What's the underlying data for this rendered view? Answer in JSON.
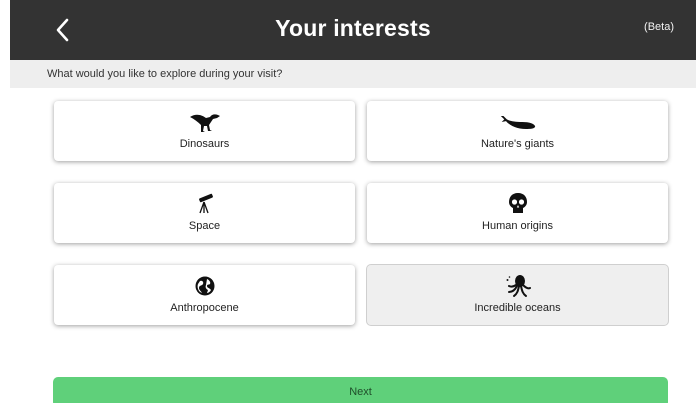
{
  "header": {
    "title": "Your interests",
    "badge": "(Beta)",
    "back_icon": "chevron-left-icon"
  },
  "prompt": "What would you like to explore during your visit?",
  "interests": [
    {
      "label": "Dinosaurs",
      "icon": "dinosaur-icon",
      "selected": false
    },
    {
      "label": "Nature's giants",
      "icon": "whale-icon",
      "selected": false
    },
    {
      "label": "Space",
      "icon": "telescope-icon",
      "selected": false
    },
    {
      "label": "Human origins",
      "icon": "skull-icon",
      "selected": false
    },
    {
      "label": "Anthropocene",
      "icon": "globe-icon",
      "selected": false
    },
    {
      "label": "Incredible oceans",
      "icon": "octopus-icon",
      "selected": true
    }
  ],
  "next_button": {
    "label": "Next"
  },
  "colors": {
    "header_bg": "#333333",
    "subheader_bg": "#eeeeee",
    "next_button": "#5fd07a",
    "selected_card": "#efefef"
  }
}
